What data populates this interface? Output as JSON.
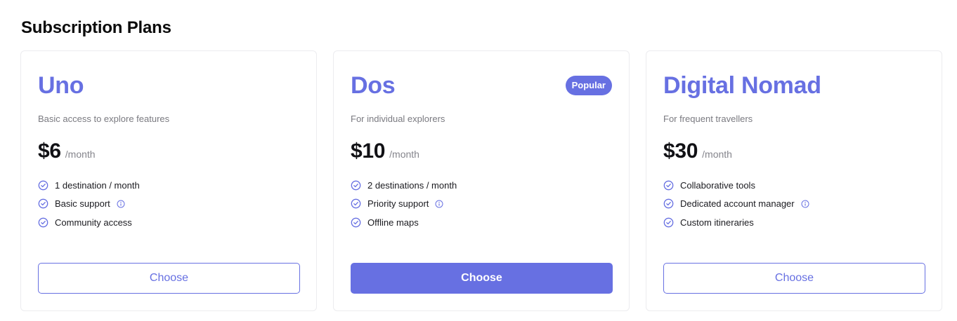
{
  "page": {
    "title": "Subscription Plans"
  },
  "colors": {
    "accent": "#6770e2",
    "text_muted": "#7a7a80",
    "card_border": "#ececef"
  },
  "icons": {
    "feature": "check-circle-icon",
    "info": "info-circle-icon"
  },
  "plans": [
    {
      "name": "Uno",
      "description": "Basic access to explore features",
      "price": "$6",
      "period": "/month",
      "badge": "",
      "features": [
        {
          "label": "1 destination / month",
          "info": false
        },
        {
          "label": "Basic support",
          "info": true
        },
        {
          "label": "Community access",
          "info": false
        }
      ],
      "button_label": "Choose",
      "highlighted": false
    },
    {
      "name": "Dos",
      "description": "For individual explorers",
      "price": "$10",
      "period": "/month",
      "badge": "Popular",
      "features": [
        {
          "label": "2 destinations / month",
          "info": false
        },
        {
          "label": "Priority support",
          "info": true
        },
        {
          "label": "Offline maps",
          "info": false
        }
      ],
      "button_label": "Choose",
      "highlighted": true
    },
    {
      "name": "Digital Nomad",
      "description": "For frequent travellers",
      "price": "$30",
      "period": "/month",
      "badge": "",
      "features": [
        {
          "label": "Collaborative tools",
          "info": false
        },
        {
          "label": "Dedicated account manager",
          "info": true
        },
        {
          "label": "Custom itineraries",
          "info": false
        }
      ],
      "button_label": "Choose",
      "highlighted": false
    }
  ]
}
